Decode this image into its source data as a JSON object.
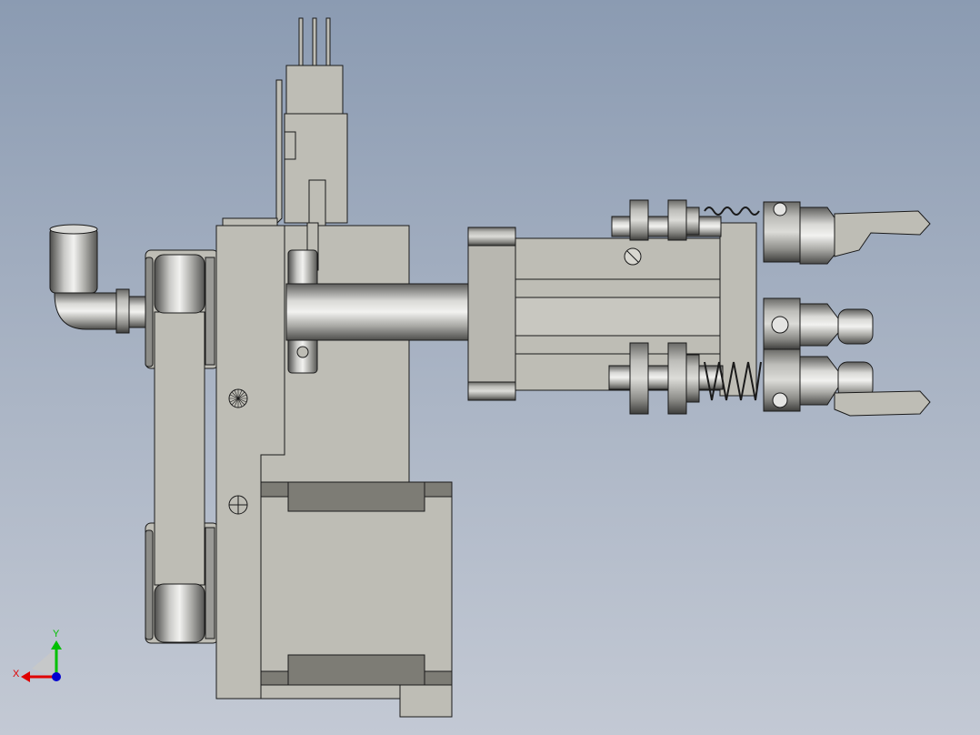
{
  "viewport": {
    "background_top": "#8b9bb2",
    "background_bottom": "#c3c9d4",
    "part_color": "#bebdb5",
    "part_dark": "#7d7c75",
    "edge_color": "#1a1a1a",
    "metal_light": "#e8e8e6",
    "metal_dark": "#5e5e5c"
  },
  "triad": {
    "x_label": "X",
    "y_label": "Y",
    "x_color": "#e00000",
    "y_color": "#00c000",
    "z_color": "#0000d0"
  },
  "icons": [
    "triad-icon",
    "elbow-fitting-icon",
    "spring-icon",
    "gripper-finger-icon"
  ]
}
